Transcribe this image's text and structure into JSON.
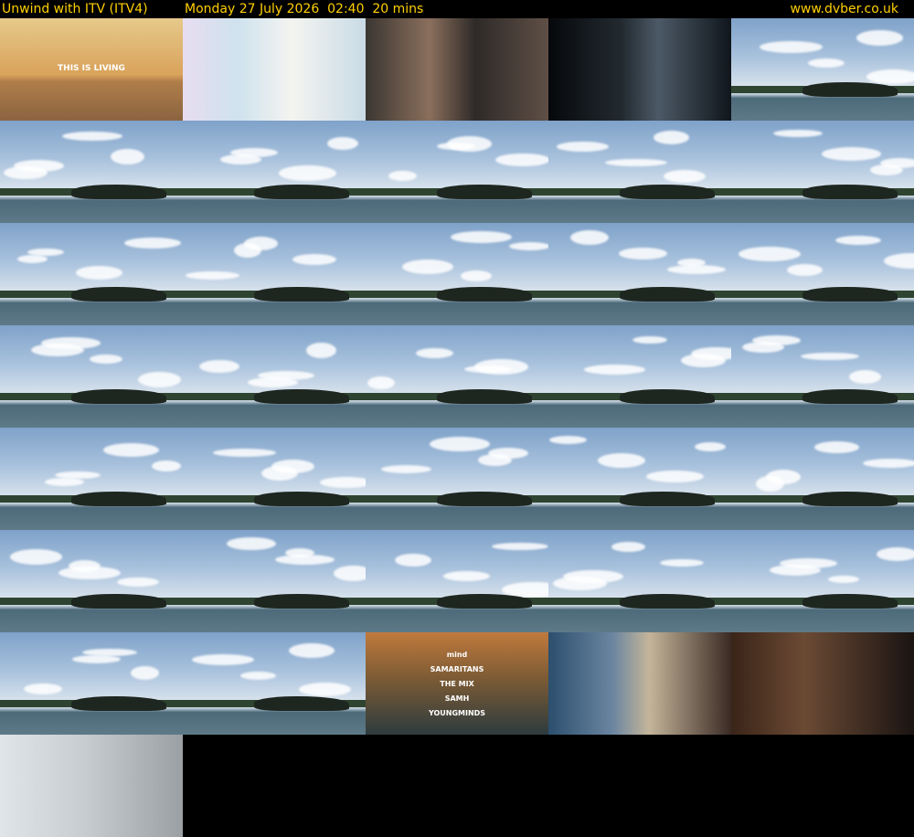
{
  "header": {
    "title": "Unwind with ITV (ITV4)",
    "datetime": "Monday 27 July 2026  02:40  20 mins",
    "site": "www.dvber.co.uk"
  },
  "colors": {
    "header_text": "#ffd000",
    "background": "#000000"
  },
  "thumbnails": [
    {
      "scene": "beach-ad",
      "text": "THIS IS   LIVING"
    },
    {
      "scene": "party-ad"
    },
    {
      "scene": "drama-clip"
    },
    {
      "scene": "dark-film-clip"
    },
    {
      "scene": "island-seascape"
    },
    {
      "scene": "island-seascape"
    },
    {
      "scene": "island-seascape"
    },
    {
      "scene": "island-seascape"
    },
    {
      "scene": "island-seascape"
    },
    {
      "scene": "island-seascape"
    },
    {
      "scene": "island-seascape"
    },
    {
      "scene": "island-seascape"
    },
    {
      "scene": "island-seascape"
    },
    {
      "scene": "island-seascape"
    },
    {
      "scene": "island-seascape"
    },
    {
      "scene": "island-seascape"
    },
    {
      "scene": "island-seascape"
    },
    {
      "scene": "island-seascape"
    },
    {
      "scene": "island-seascape"
    },
    {
      "scene": "island-seascape"
    },
    {
      "scene": "island-seascape"
    },
    {
      "scene": "island-seascape"
    },
    {
      "scene": "island-seascape"
    },
    {
      "scene": "island-seascape"
    },
    {
      "scene": "island-seascape"
    },
    {
      "scene": "island-seascape"
    },
    {
      "scene": "island-seascape"
    },
    {
      "scene": "island-seascape"
    },
    {
      "scene": "island-seascape"
    },
    {
      "scene": "island-seascape"
    },
    {
      "scene": "island-seascape"
    },
    {
      "scene": "island-seascape"
    },
    {
      "scene": "mental-health-promo",
      "lines": [
        "mind",
        "SAMARITANS",
        "THE MIX",
        "SAMH",
        "YOUNGMINDS"
      ]
    },
    {
      "scene": "kitchen-ad"
    },
    {
      "scene": "tablet-ad"
    },
    {
      "scene": "laundry-ad"
    }
  ]
}
